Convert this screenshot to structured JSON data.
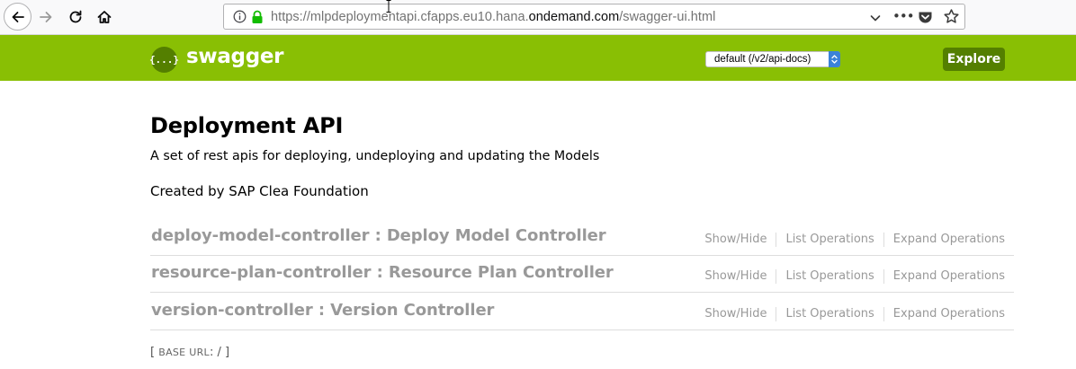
{
  "browser": {
    "url": {
      "prefix": "https://mlpdeploymentapi.cfapps.eu10.hana.",
      "domain": "ondemand.com",
      "suffix": "/swagger-ui.html"
    },
    "menu_dots": "•••",
    "icons": [
      "back-arrow-icon",
      "forward-arrow-icon",
      "reload-icon",
      "home-icon",
      "info-icon",
      "lock-icon",
      "chevron-down-icon",
      "pocket-icon",
      "star-icon"
    ]
  },
  "header": {
    "logo_symbol": "{...}",
    "logo_text": "swagger",
    "api_select_value": "default (/v2/api-docs)",
    "explore_label": "Explore",
    "colors": {
      "bar": "#89bf04",
      "button": "#547f00",
      "select_arrows": "#3b82d8"
    }
  },
  "info": {
    "title": "Deployment API",
    "description": "A set of rest apis for deploying, undeploying and updating the Models",
    "created_by": "Created by SAP Clea Foundation"
  },
  "resources": [
    {
      "heading": "deploy-model-controller : Deploy Model Controller",
      "show_hide": "Show/Hide",
      "list_ops": "List Operations",
      "expand_ops": "Expand Operations"
    },
    {
      "heading": "resource-plan-controller : Resource Plan Controller",
      "show_hide": "Show/Hide",
      "list_ops": "List Operations",
      "expand_ops": "Expand Operations"
    },
    {
      "heading": "version-controller : Version Controller",
      "show_hide": "Show/Hide",
      "list_ops": "List Operations",
      "expand_ops": "Expand Operations"
    }
  ],
  "footer": {
    "open_bracket": "[ ",
    "base_url_label": "BASE URL",
    "base_url_value": ": / ]"
  }
}
